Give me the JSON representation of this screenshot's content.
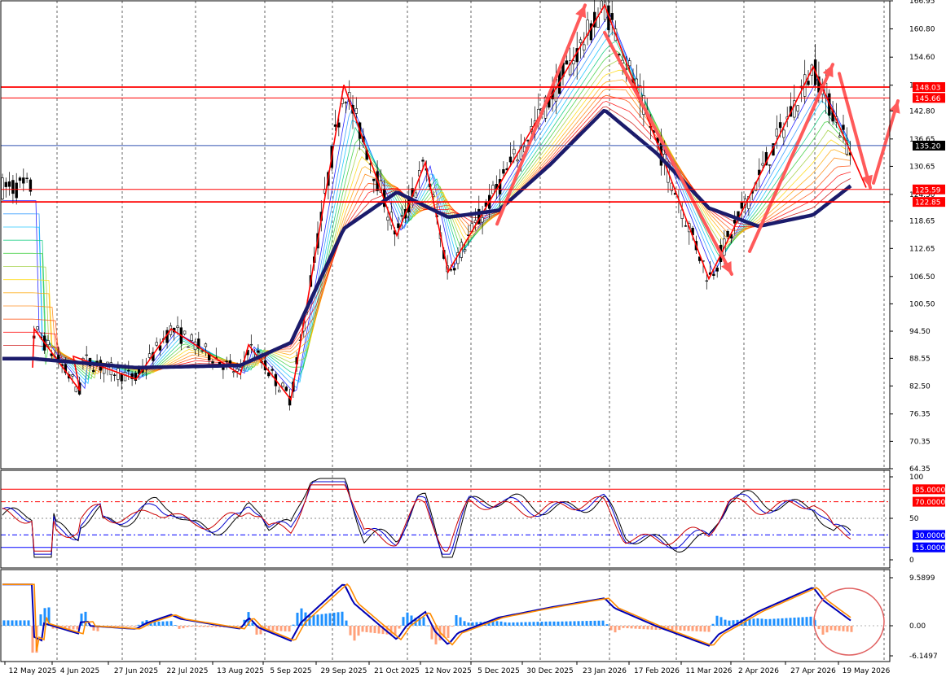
{
  "chart_data": [
    {
      "type": "candlestick",
      "panel": "price",
      "y_ticks": [
        "166.95",
        "160.80",
        "154.60",
        "148.45",
        "142.80",
        "136.65",
        "130.65",
        "124.50",
        "118.65",
        "112.65",
        "106.50",
        "100.50",
        "94.50",
        "88.55",
        "82.50",
        "76.35",
        "70.35",
        "64.35"
      ],
      "ylim": [
        64.35,
        166.95
      ],
      "price_tags": [
        {
          "label": "148.03",
          "value": 148.03,
          "color": "#ff0000"
        },
        {
          "label": "145.66",
          "value": 145.66,
          "color": "#ff0000"
        },
        {
          "label": "135.20",
          "value": 135.2,
          "color": "#000000"
        },
        {
          "label": "125.59",
          "value": 125.59,
          "color": "#ff0000"
        },
        {
          "label": "122.85",
          "value": 122.85,
          "color": "#ff0000"
        }
      ],
      "zigzag": [
        {
          "x": "12 May 2025",
          "y": 86.5
        },
        {
          "x": "May 2025",
          "y": 95.0
        },
        {
          "x": "4 Jun 2025",
          "y": 81.5
        },
        {
          "x": "Jun 2025",
          "y": 89.0
        },
        {
          "x": "27 Jun 2025",
          "y": 84.0
        },
        {
          "x": "Jul 2025",
          "y": 95.0
        },
        {
          "x": "13 Aug 2025",
          "y": 85.0
        },
        {
          "x": "Aug 2025",
          "y": 91.5
        },
        {
          "x": "5 Sep 2025",
          "y": 79.5
        },
        {
          "x": "29 Sep 2025",
          "y": 148.5
        },
        {
          "x": "21 Oct 2025",
          "y": 115.5
        },
        {
          "x": "Nov 2025",
          "y": 131.5
        },
        {
          "x": "12 Nov 2025",
          "y": 107.5
        },
        {
          "x": "23 Jan 2026",
          "y": 166.0
        },
        {
          "x": "11 Mar 2026",
          "y": 106.0
        },
        {
          "x": "27 Apr 2026",
          "y": 152.5
        },
        {
          "x": "19 May 2026",
          "y": 126.0
        }
      ],
      "moving_average_thick": [
        {
          "x": "12 May 2025",
          "y": 88.5
        },
        {
          "x": "27 Jun 2025",
          "y": 86.5
        },
        {
          "x": "13 Aug 2025",
          "y": 87.0
        },
        {
          "x": "5 Sep 2025",
          "y": 92.0
        },
        {
          "x": "29 Sep 2025",
          "y": 117.0
        },
        {
          "x": "21 Oct 2025",
          "y": 125.0
        },
        {
          "x": "12 Nov 2025",
          "y": 119.5
        },
        {
          "x": "5 Dec 2025",
          "y": 121.0
        },
        {
          "x": "30 Dec 2025",
          "y": 131.0
        },
        {
          "x": "23 Jan 2026",
          "y": 143.0
        },
        {
          "x": "17 Feb 2026",
          "y": 133.5
        },
        {
          "x": "11 Mar 2026",
          "y": 121.5
        },
        {
          "x": "2 Apr 2026",
          "y": 117.5
        },
        {
          "x": "27 Apr 2026",
          "y": 120.0
        },
        {
          "x": "19 May 2026",
          "y": 129.0
        }
      ]
    },
    {
      "type": "line",
      "panel": "oscillator",
      "y_ticks": [
        "100",
        "50",
        "0"
      ],
      "ylim": [
        0,
        100
      ],
      "levels": [
        {
          "label": "85.0000",
          "value": 85,
          "color": "#ff0000"
        },
        {
          "label": "70.0000",
          "value": 70,
          "color": "#ff0000"
        },
        {
          "label": "30.0000",
          "value": 30,
          "color": "#0000ff"
        },
        {
          "label": "15.0000",
          "value": 15,
          "color": "#0000ff"
        }
      ]
    },
    {
      "type": "bar",
      "panel": "macd",
      "y_ticks": [
        "9.5899",
        "0.00",
        "-6.1497"
      ],
      "ylim": [
        -6.1497,
        9.5899
      ]
    }
  ],
  "x_axis_labels": [
    "12 May 2025",
    "4 Jun 2025",
    "27 Jun 2025",
    "22 Jul 2025",
    "13 Aug 2025",
    "5 Sep 2025",
    "29 Sep 2025",
    "21 Oct 2025",
    "12 Nov 2025",
    "5 Dec 2025",
    "30 Dec 2025",
    "23 Jan 2026",
    "17 Feb 2026",
    "11 Mar 2026",
    "2 Apr 2026",
    "27 Apr 2026",
    "19 May 2026"
  ],
  "colors": {
    "thick_ma": "#1b1b6b",
    "zigzag": "#ff0000",
    "arrows": "#ff5a5a",
    "macd_line": "#0000b4",
    "signal_line": "#ff8c00",
    "hist_pos": "#1e90ff",
    "hist_neg": "#ffa07a"
  }
}
